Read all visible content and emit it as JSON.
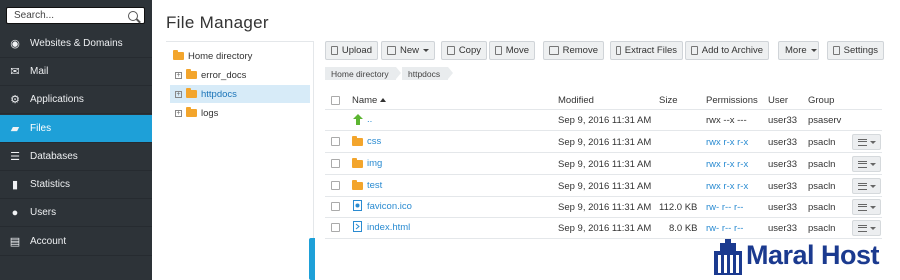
{
  "search": {
    "placeholder": "Search..."
  },
  "nav": {
    "items": [
      {
        "label": "Websites & Domains",
        "icon": "globe-icon",
        "active": false
      },
      {
        "label": "Mail",
        "icon": "envelope-icon",
        "active": false
      },
      {
        "label": "Applications",
        "icon": "gear-icon",
        "active": false
      },
      {
        "label": "Files",
        "icon": "folder-icon",
        "active": true
      },
      {
        "label": "Databases",
        "icon": "database-icon",
        "active": false
      },
      {
        "label": "Statistics",
        "icon": "bar-chart-icon",
        "active": false
      },
      {
        "label": "Users",
        "icon": "user-icon",
        "active": false
      },
      {
        "label": "Account",
        "icon": "id-card-icon",
        "active": false
      }
    ]
  },
  "page": {
    "title": "File Manager"
  },
  "tree": {
    "root": "Home directory",
    "children": [
      {
        "label": "error_docs",
        "selected": false
      },
      {
        "label": "httpdocs",
        "selected": true
      },
      {
        "label": "logs",
        "selected": false
      }
    ]
  },
  "toolbar": {
    "upload": "Upload",
    "new": "New",
    "copy": "Copy",
    "move": "Move",
    "remove": "Remove",
    "extract": "Extract Files",
    "archive": "Add to Archive",
    "more": "More",
    "settings": "Settings"
  },
  "breadcrumb": [
    "Home directory",
    "httpdocs"
  ],
  "table": {
    "headers": {
      "name": "Name",
      "modified": "Modified",
      "size": "Size",
      "permissions": "Permissions",
      "user": "User",
      "group": "Group"
    },
    "rows": [
      {
        "name": "..",
        "type": "parent",
        "modified": "Sep 9, 2016 11:31 AM",
        "size": "",
        "permissions": "rwx --x ---",
        "user": "user33",
        "group": "psaserv"
      },
      {
        "name": "css",
        "type": "folder",
        "modified": "Sep 9, 2016 11:31 AM",
        "size": "",
        "permissions": "rwx r-x r-x",
        "user": "user33",
        "group": "psacln"
      },
      {
        "name": "img",
        "type": "folder",
        "modified": "Sep 9, 2016 11:31 AM",
        "size": "",
        "permissions": "rwx r-x r-x",
        "user": "user33",
        "group": "psacln"
      },
      {
        "name": "test",
        "type": "folder",
        "modified": "Sep 9, 2016 11:31 AM",
        "size": "",
        "permissions": "rwx r-x r-x",
        "user": "user33",
        "group": "psacln"
      },
      {
        "name": "favicon.ico",
        "type": "file",
        "modified": "Sep 9, 2016 11:31 AM",
        "size": "112.0 KB",
        "permissions": "rw- r-- r--",
        "user": "user33",
        "group": "psacln"
      },
      {
        "name": "index.html",
        "type": "file",
        "modified": "Sep 9, 2016 11:31 AM",
        "size": "8.0 KB",
        "permissions": "rw- r-- r--",
        "user": "user33",
        "group": "psacln"
      }
    ]
  },
  "watermark": {
    "brand": "Maral Host"
  },
  "colors": {
    "sidebar": "#2d3338",
    "accent": "#1ea0d8",
    "folder": "#f3a52c",
    "link": "#2a8bd1",
    "brand": "#1b3a8f"
  }
}
